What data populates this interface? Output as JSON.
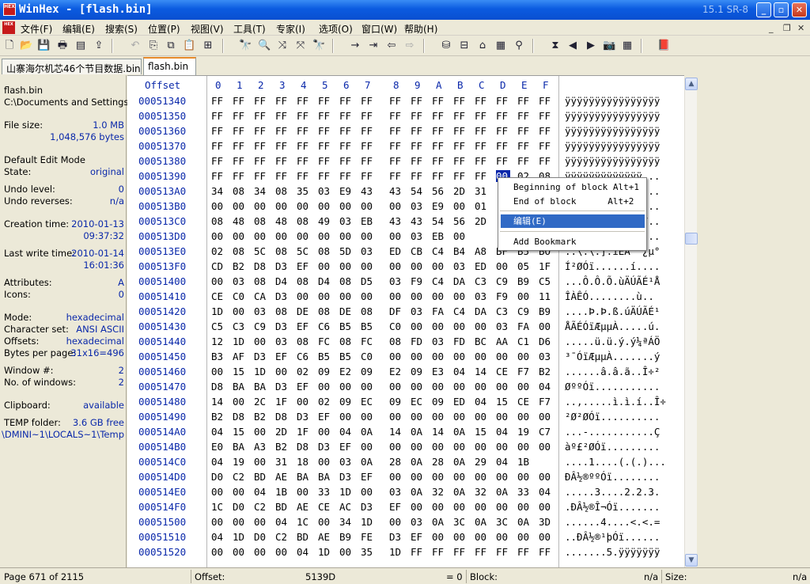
{
  "window": {
    "title": "WinHex - [flash.bin]",
    "version": "15.1 SR-8",
    "logo_text": "HEX"
  },
  "menu": [
    "文件(F)",
    "编辑(E)",
    "搜索(S)",
    "位置(P)",
    "视图(V)",
    "工具(T)",
    "专家(I)",
    "选项(O)",
    "窗口(W)",
    "帮助(H)"
  ],
  "tabs": [
    "山寨海尔机芯46个节目数据.bin",
    "flash.bin"
  ],
  "info": {
    "file_name": "flash.bin",
    "path": "C:\\Documents and Settings",
    "file_size_label": "File size:",
    "file_size_mb": "1.0 MB",
    "file_size_bytes": "1,048,576 bytes",
    "edit_mode_label": "Default Edit Mode",
    "state_label": "State:",
    "state_value": "original",
    "undo_level_label": "Undo level:",
    "undo_level_value": "0",
    "undo_rev_label": "Undo reverses:",
    "undo_rev_value": "n/a",
    "creation_label": "Creation time:",
    "creation_date": "2010-01-13",
    "creation_time": "09:37:32",
    "lastwrite_label": "Last write time:",
    "lastwrite_date": "2010-01-14",
    "lastwrite_time": "16:01:36",
    "attributes_label": "Attributes:",
    "attributes_value": "A",
    "icons_label": "Icons:",
    "icons_value": "0",
    "mode_label": "Mode:",
    "mode_value": "hexadecimal",
    "charset_label": "Character set:",
    "charset_value": "ANSI ASCII",
    "offsets_label": "Offsets:",
    "offsets_value": "hexadecimal",
    "bpp_label": "Bytes per page:",
    "bpp_value": "31x16=496",
    "window_num_label": "Window #:",
    "window_num_value": "2",
    "windows_label": "No. of windows:",
    "windows_value": "2",
    "clipboard_label": "Clipboard:",
    "clipboard_value": "available",
    "temp_label": "TEMP folder:",
    "temp_value": "3.6 GB free",
    "temp_path": "\\DMINI~1\\LOCALS~1\\Temp"
  },
  "hex": {
    "offset_header": "Offset",
    "columns": [
      "0",
      "1",
      "2",
      "3",
      "4",
      "5",
      "6",
      "7",
      "8",
      "9",
      "A",
      "B",
      "C",
      "D",
      "E",
      "F"
    ],
    "rows": [
      {
        "offset": "00051340",
        "bytes": "FF FF FF FF FF FF FF FF FF FF FF FF FF FF FF FF",
        "text": "ÿÿÿÿÿÿÿÿÿÿÿÿÿÿÿÿ"
      },
      {
        "offset": "00051350",
        "bytes": "FF FF FF FF FF FF FF FF FF FF FF FF FF FF FF FF",
        "text": "ÿÿÿÿÿÿÿÿÿÿÿÿÿÿÿÿ"
      },
      {
        "offset": "00051360",
        "bytes": "FF FF FF FF FF FF FF FF FF FF FF FF FF FF FF FF",
        "text": "ÿÿÿÿÿÿÿÿÿÿÿÿÿÿÿÿ"
      },
      {
        "offset": "00051370",
        "bytes": "FF FF FF FF FF FF FF FF FF FF FF FF FF FF FF FF",
        "text": "ÿÿÿÿÿÿÿÿÿÿÿÿÿÿÿÿ"
      },
      {
        "offset": "00051380",
        "bytes": "FF FF FF FF FF FF FF FF FF FF FF FF FF FF FF FF",
        "text": "ÿÿÿÿÿÿÿÿÿÿÿÿÿÿÿÿ"
      },
      {
        "offset": "00051390",
        "bytes": "FF FF FF FF FF FF FF FF FF FF FF FF FF 00 02 08",
        "text": "ÿÿÿÿÿÿÿÿÿÿÿÿÿ..."
      },
      {
        "offset": "000513A0",
        "bytes": "34 08 34 08 35 03 E9 43 43 54 56 2D 31 ",
        "text": "4.4.5.éCCTV-1..."
      },
      {
        "offset": "000513B0",
        "bytes": "00 00 00 00 00 00 00 00 00 03 E9 00 01 ",
        "text": "..........é....."
      },
      {
        "offset": "000513C0",
        "bytes": "08 48 08 48 08 49 03 EB 43 43 54 56 2D ",
        "text": ".H.H.I.ëCCTV-7.."
      },
      {
        "offset": "000513D0",
        "bytes": "00 00 00 00 00 00 00 00 00 03 EB 00 ",
        "text": "..........ë....."
      },
      {
        "offset": "000513E0",
        "bytes": "02 08 5C 08 5C 08 5D 03 ED CB C4 B4 A8 BF B5 BO",
        "text": "..\\.\\.].íËÄ´¨¿µ°"
      },
      {
        "offset": "000513F0",
        "bytes": "CD B2 D8 D3 EF 00 00 00 00 00 00 03 ED 00 05 1F",
        "text": "Í²ØÓï......í...."
      },
      {
        "offset": "00051400",
        "bytes": "00 03 08 D4 08 D4 08 D5 03 F9 C4 DA C3 C9 B9 C5",
        "text": "...Ô.Ô.Õ.ùÄÚÃÉ¹Å"
      },
      {
        "offset": "00051410",
        "bytes": "CE C0 CA D3 00 00 00 00 00 00 00 00 03 F9 00 11",
        "text": "ÎÀÊÓ........ù.."
      },
      {
        "offset": "00051420",
        "bytes": "1D 00 03 08 DE 08 DE 08 DF 03 FA C4 DA C3 C9 B9",
        "text": "....Þ.Þ.ß.úÄÚÃÉ¹"
      },
      {
        "offset": "00051430",
        "bytes": "C5 C3 C9 D3 EF C6 B5 B5 C0 00 00 00 00 03 FA 00",
        "text": "ÅÃÉÓïÆµµÀ.....ú."
      },
      {
        "offset": "00051440",
        "bytes": "12 1D 00 03 08 FC 08 FC 08 FD 03 FD BC AA C1 D6",
        "text": ".....ü.ü.ý.ý¼ªÁÖ"
      },
      {
        "offset": "00051450",
        "bytes": "B3 AF D3 EF C6 B5 B5 C0 00 00 00 00 00 00 00 03",
        "text": "³¯ÓïÆµµÀ.......ý"
      },
      {
        "offset": "00051460",
        "bytes": "00 15 1D 00 02 09 E2 09 E2 09 E3 04 14 CE F7 B2",
        "text": "......â.â.ã..Î÷²"
      },
      {
        "offset": "00051470",
        "bytes": "D8 BA BA D3 EF 00 00 00 00 00 00 00 00 00 00 04",
        "text": "ØººÓï..........."
      },
      {
        "offset": "00051480",
        "bytes": "14 00 2C 1F 00 02 09 EC 09 EC 09 ED 04 15 CE F7",
        "text": "..,.....ì.ì.í..Î÷"
      },
      {
        "offset": "00051490",
        "bytes": "B2 D8 B2 D8 D3 EF 00 00 00 00 00 00 00 00 00 00",
        "text": "²Ø²ØÓï.........."
      },
      {
        "offset": "000514A0",
        "bytes": "04 15 00 2D 1F 00 04 0A 14 0A 14 0A 15 04 19 C7",
        "text": "...-...........Ç"
      },
      {
        "offset": "000514B0",
        "bytes": "E0 BA A3 B2 D8 D3 EF 00 00 00 00 00 00 00 00 00",
        "text": "àº£²ØÓï........."
      },
      {
        "offset": "000514C0",
        "bytes": "04 19 00 31 18 00 03 0A 28 0A 28 0A 29 04 1B",
        "text": "....1....(.(.)..."
      },
      {
        "offset": "000514D0",
        "bytes": "D0 C2 BD AE BA BA D3 EF 00 00 00 00 00 00 00 00",
        "text": "ÐÂ½®ººÓï........"
      },
      {
        "offset": "000514E0",
        "bytes": "00 00 04 1B 00 33 1D 00 03 0A 32 0A 32 0A 33 04",
        "text": ".....3....2.2.3."
      },
      {
        "offset": "000514F0",
        "bytes": "1C D0 C2 BD AE CE AC D3 EF 00 00 00 00 00 00 00",
        "text": ".ÐÂ½®Î¬Óï......."
      },
      {
        "offset": "00051500",
        "bytes": "00 00 00 04 1C 00 34 1D 00 03 0A 3C 0A 3C 0A 3D",
        "text": "......4....<.<.="
      },
      {
        "offset": "00051510",
        "bytes": "04 1D D0 C2 BD AE B9 FE D3 EF 00 00 00 00 00 00",
        "text": "..ÐÂ½®¹þÓï......"
      },
      {
        "offset": "00051520",
        "bytes": "00 00 00 00 04 1D 00 35 1D FF FF FF FF FF FF FF",
        "text": ".......5.ÿÿÿÿÿÿÿ"
      }
    ]
  },
  "context_menu": {
    "begin": "Beginning of block Alt+1",
    "end": "End of block      Alt+2",
    "edit": "编辑(E)",
    "bookmark": "Add Bookmark"
  },
  "status": {
    "page": "Page 671 of 2115",
    "offset_label": "Offset:",
    "offset_value": "5139D",
    "eq": "= 0",
    "block_label": "Block:",
    "block_value": "n/a",
    "size_label": "Size:",
    "size_value": "n/a"
  },
  "colors": {
    "title_blue": "#0B5BE0",
    "value_blue": "#0A28AA",
    "highlight": "#316AC5"
  }
}
